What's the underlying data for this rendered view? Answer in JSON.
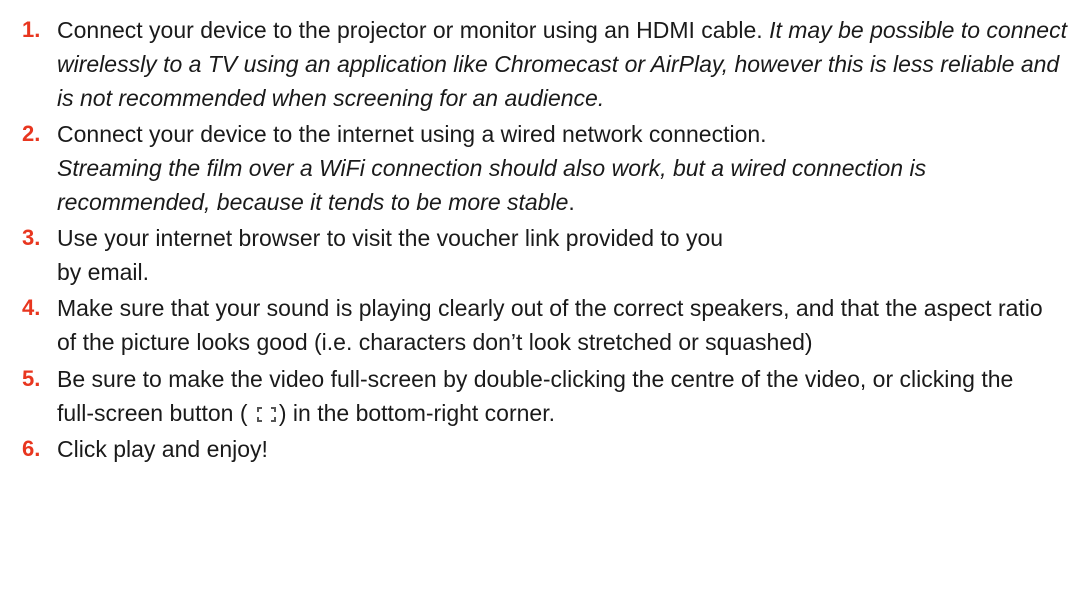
{
  "steps": [
    {
      "number": "1.",
      "text": "Connect your device to the projector or monitor using an HDMI cable.",
      "note": "It may be possible to connect wirelessly to a TV using an application like Chromecast or AirPlay, however this is less reliable and is not recommended when screening for an audience."
    },
    {
      "number": "2.",
      "text": "Connect your device to the internet using a wired network connection.",
      "note": "Streaming the film over a WiFi connection should also work, but a wired connection is recommended, because it tends to be more stable",
      "note_end": "."
    },
    {
      "number": "3.",
      "text": "Use your internet browser to visit the voucher link provided to you by email."
    },
    {
      "number": "4.",
      "text": "Make sure that your sound is playing clearly out of the correct speakers, and that the aspect ratio of the picture looks good (i.e. characters don’t look stretched or squashed)"
    },
    {
      "number": "5.",
      "text_before_icon": "Be sure to make the video full-screen by double-clicking the centre of the video, or clicking the full-screen button (",
      "icon": "fullscreen-icon",
      "text_after_icon": ") in the bottom-right corner."
    },
    {
      "number": "6.",
      "text": "Click play and enjoy!"
    }
  ],
  "colors": {
    "number": "#e8361f",
    "text": "#1a1a1a"
  }
}
